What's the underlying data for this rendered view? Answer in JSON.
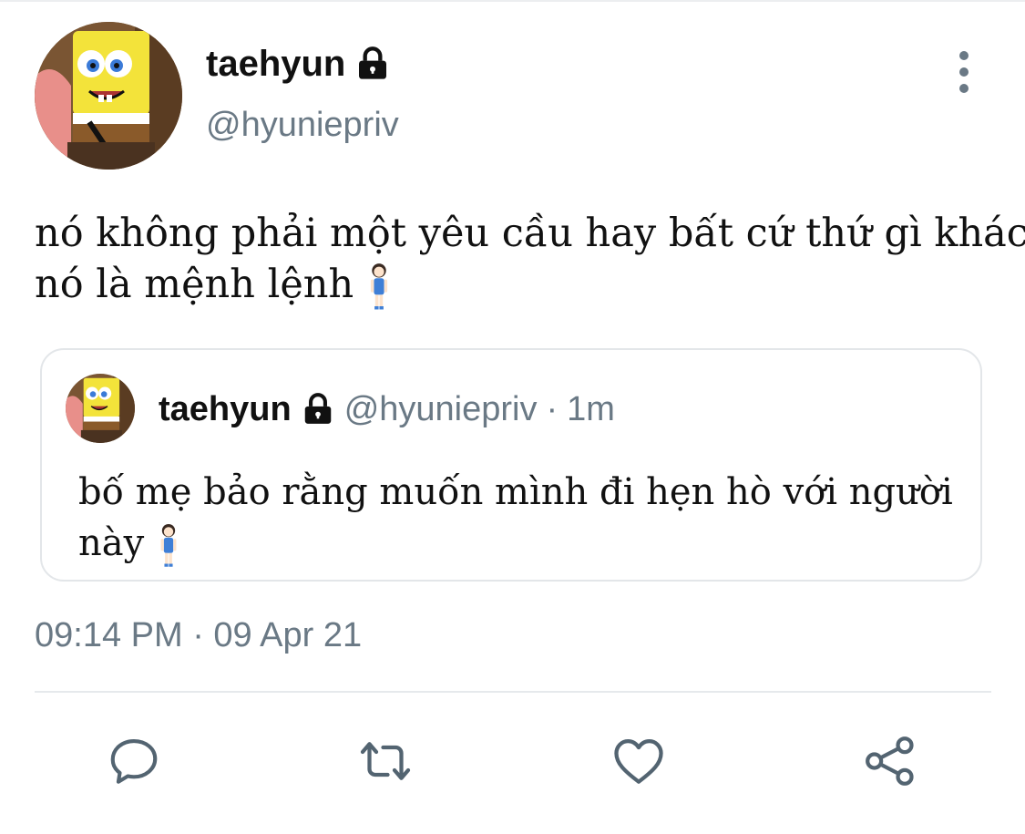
{
  "tweet": {
    "author": {
      "display_name": "taehyun",
      "handle": "@hyuniepriv",
      "avatar_icon": "spongebob-avatar",
      "locked_icon": "lock-icon"
    },
    "text_lines": [
      "nó không phải một yêu cầu hay bất cứ thứ gì khác",
      "nó là mệnh lệnh"
    ],
    "text_emoji": "woman-standing-emoji",
    "timestamp": "09:14 PM · 09 Apr 21"
  },
  "quoted_tweet": {
    "display_name": "taehyun",
    "handle": "@hyuniepriv",
    "separator": "·",
    "time": "1m",
    "text_lines": [
      "bố mẹ bảo rằng muốn mình đi hẹn hò với người",
      "này"
    ],
    "text_emoji": "woman-standing-emoji"
  },
  "actions": [
    {
      "name": "reply",
      "icon": "reply-icon"
    },
    {
      "name": "retweet",
      "icon": "retweet-icon"
    },
    {
      "name": "like",
      "icon": "heart-icon"
    },
    {
      "name": "share",
      "icon": "share-icon"
    }
  ],
  "colors": {
    "text": "#111111",
    "muted": "#6a7985",
    "border": "#e3e6e9"
  }
}
